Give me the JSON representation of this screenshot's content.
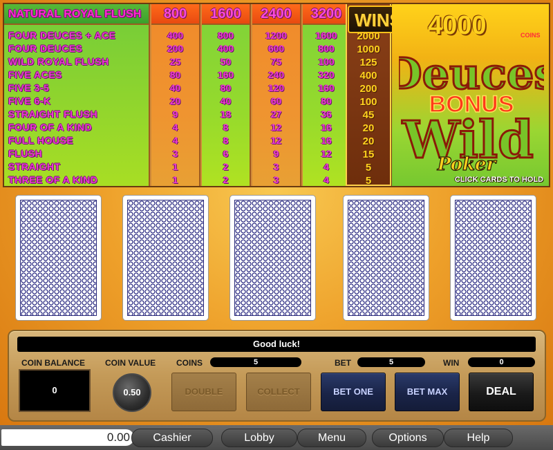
{
  "paytable": {
    "header_row_label": "NATURAL ROYAL FLUSH",
    "header_values": [
      "800",
      "1600",
      "2400",
      "3200"
    ],
    "rows": [
      {
        "hand": "FOUR DEUCES + ACE",
        "values": [
          "400",
          "800",
          "1200",
          "1600"
        ],
        "win": "2000"
      },
      {
        "hand": "FOUR DEUCES",
        "values": [
          "200",
          "400",
          "600",
          "800"
        ],
        "win": "1000"
      },
      {
        "hand": "WILD ROYAL FLUSH",
        "values": [
          "25",
          "50",
          "75",
          "100"
        ],
        "win": "125"
      },
      {
        "hand": "FIVE ACES",
        "values": [
          "80",
          "160",
          "240",
          "320"
        ],
        "win": "400"
      },
      {
        "hand": "FIVE 3-5",
        "values": [
          "40",
          "80",
          "120",
          "160"
        ],
        "win": "200"
      },
      {
        "hand": "FIVE 6-K",
        "values": [
          "20",
          "40",
          "60",
          "80"
        ],
        "win": "100"
      },
      {
        "hand": "STRAIGHT FLUSH",
        "values": [
          "9",
          "18",
          "27",
          "36"
        ],
        "win": "45"
      },
      {
        "hand": "FOUR OF A KIND",
        "values": [
          "4",
          "8",
          "12",
          "16"
        ],
        "win": "20"
      },
      {
        "hand": "FULL HOUSE",
        "values": [
          "4",
          "8",
          "12",
          "16"
        ],
        "win": "20"
      },
      {
        "hand": "FLUSH",
        "values": [
          "3",
          "6",
          "9",
          "12"
        ],
        "win": "15"
      },
      {
        "hand": "STRAIGHT",
        "values": [
          "1",
          "2",
          "3",
          "4"
        ],
        "win": "5"
      },
      {
        "hand": "THREE OF A KIND",
        "values": [
          "1",
          "2",
          "3",
          "4"
        ],
        "win": "5"
      }
    ]
  },
  "wins": {
    "label": "WINS",
    "amount": "4000",
    "unit": "COINS"
  },
  "logo": {
    "line1": "Deuces",
    "line2": "BONUS",
    "line3": "Wild",
    "line4": "Poker",
    "hint": "CLICK CARDS TO HOLD"
  },
  "cards": [
    {
      "state": "face-down"
    },
    {
      "state": "face-down"
    },
    {
      "state": "face-down"
    },
    {
      "state": "face-down"
    },
    {
      "state": "face-down"
    }
  ],
  "panel": {
    "message": "Good luck!",
    "coin_balance_label": "COIN BALANCE",
    "coin_balance": "0",
    "coin_value_label": "COIN VALUE",
    "coin_value": "0.50",
    "coins_label": "COINS",
    "coins": "5",
    "bet_label": "BET",
    "bet": "5",
    "win_label": "WIN",
    "win": "0",
    "buttons": {
      "double": "DOUBLE",
      "collect": "COLLECT",
      "bet_one": "BET ONE",
      "bet_max": "BET MAX",
      "deal": "DEAL"
    }
  },
  "bottom_bar": {
    "balance": "0.00",
    "cashier": "Cashier",
    "lobby": "Lobby",
    "menu": "Menu",
    "options": "Options",
    "help": "Help"
  },
  "colors": {
    "background": "#eea02a",
    "paytable_text": "#ee3ad2",
    "wins_text": "#ffd21e",
    "button_blue": "#1a2448"
  }
}
